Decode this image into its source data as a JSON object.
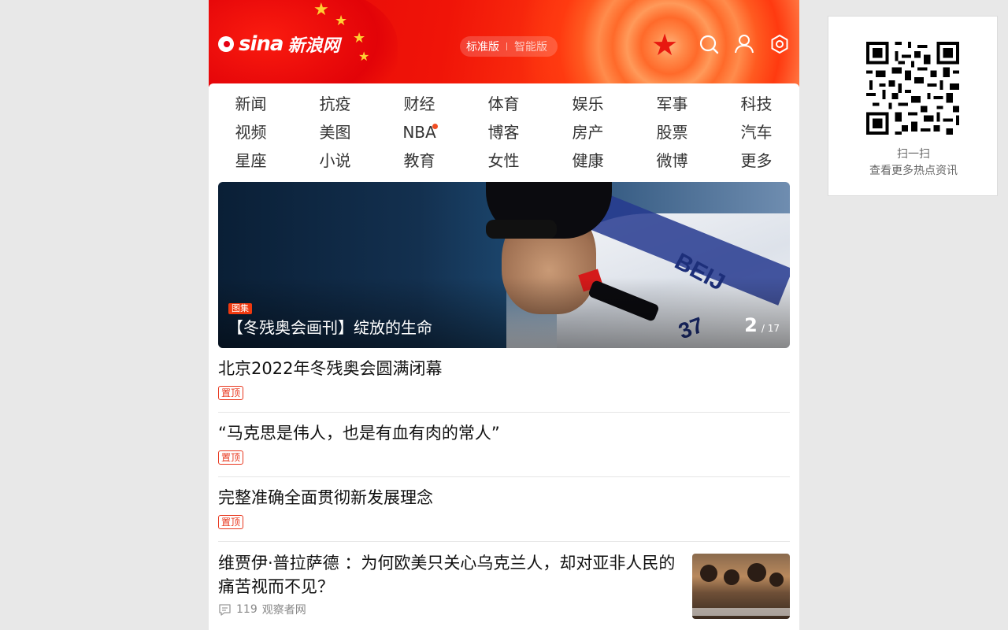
{
  "header": {
    "logo_latin": "sina",
    "logo_cn": "新浪网",
    "mode_standard": "标准版",
    "mode_smart": "智能版",
    "icons": [
      "search-icon",
      "user-icon",
      "settings-icon"
    ],
    "colors": {
      "brand_red": "#e60012",
      "accent_orange": "#f0390f"
    }
  },
  "nav": {
    "items": [
      "新闻",
      "抗疫",
      "财经",
      "体育",
      "娱乐",
      "军事",
      "科技",
      "视频",
      "美图",
      "NBA",
      "博客",
      "房产",
      "股票",
      "汽车",
      "星座",
      "小说",
      "教育",
      "女性",
      "健康",
      "微博",
      "更多"
    ]
  },
  "hero": {
    "tag": "图集",
    "title": "【冬残奥会画刊】绽放的生命",
    "page_current": "2",
    "page_total": "/ 17",
    "jersey_text_1": "BEIJ",
    "jersey_text_2": "37"
  },
  "feed": {
    "pinned": [
      {
        "title": "北京2022年冬残奥会圆满闭幕",
        "tag": "置顶"
      },
      {
        "title": "“马克思是伟人，也是有血有肉的常人”",
        "tag": "置顶"
      },
      {
        "title": "完整准确全面贯彻新发展理念",
        "tag": "置顶"
      }
    ],
    "article": {
      "title": "维贾伊·普拉萨德 ：为何欧美只关心乌克兰人，却对亚非人民的痛苦视而不见？",
      "comments": "119",
      "source": "观察者网"
    }
  },
  "qr": {
    "line1": "扫一扫",
    "line2": "查看更多热点资讯"
  }
}
